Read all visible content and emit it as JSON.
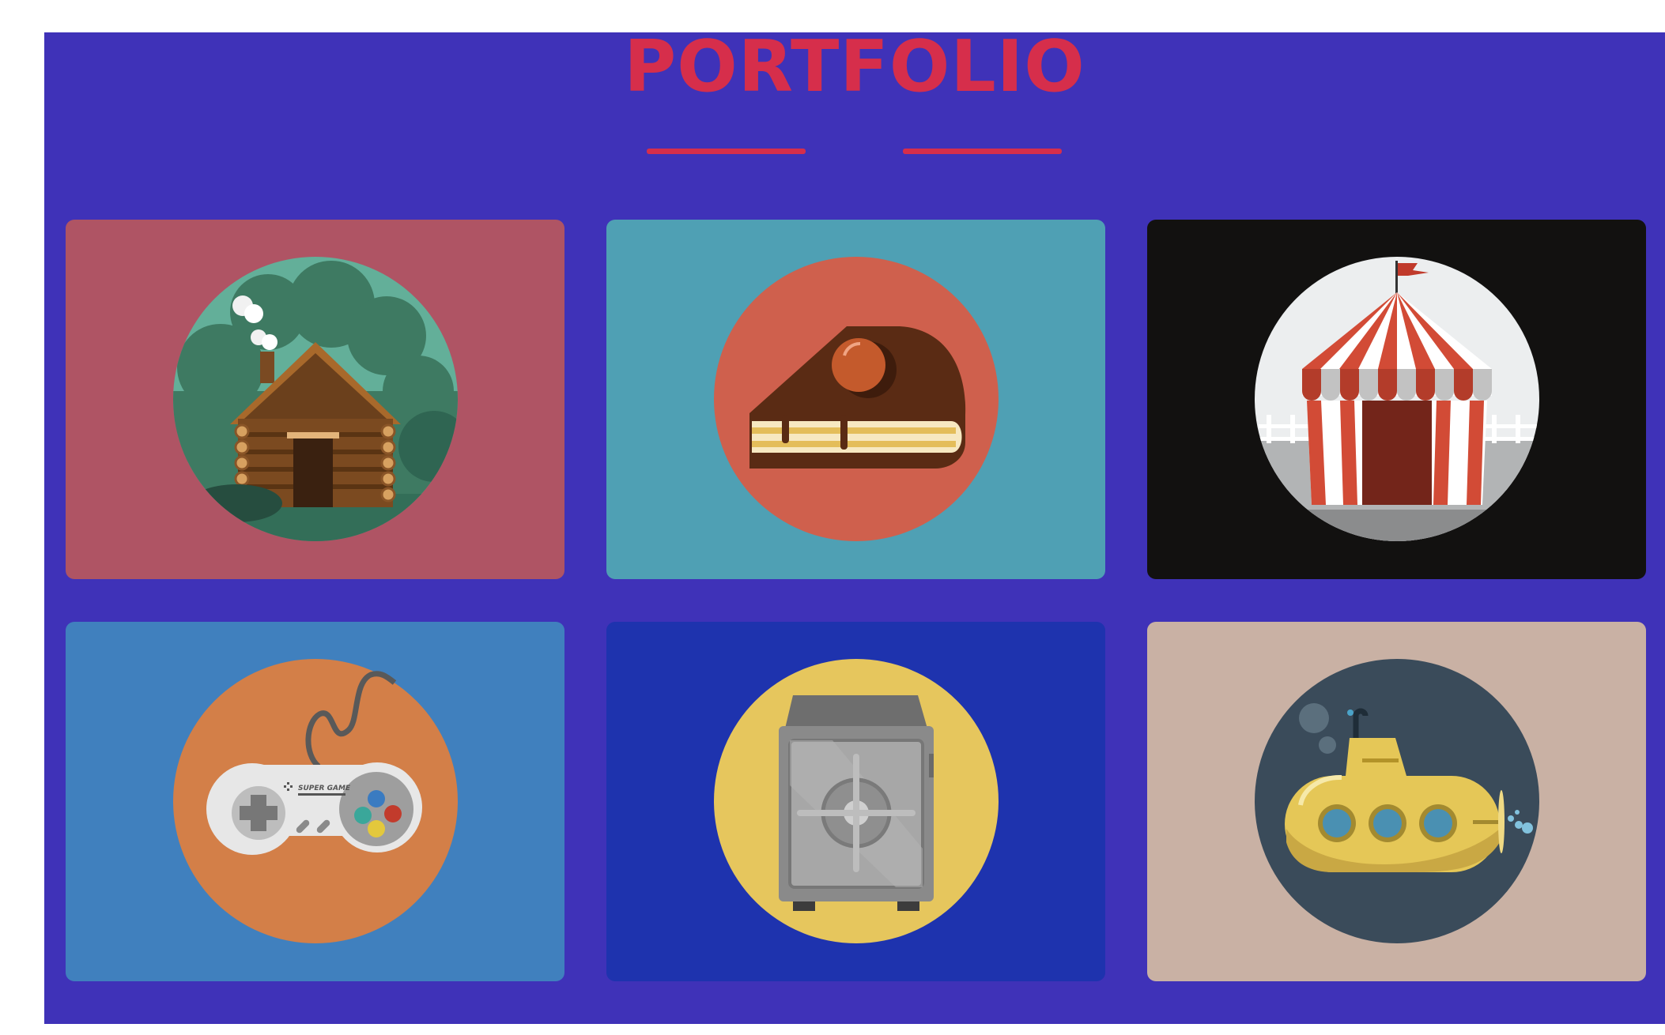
{
  "portfolio": {
    "title": "PORTFOLIO",
    "colors": {
      "section_bg": "#3f32b8",
      "accent": "#d62e4b"
    },
    "items": [
      {
        "icon": "log-cabin-icon",
        "bg": "#af5464"
      },
      {
        "icon": "cake-slice-icon",
        "bg": "#4fa0b4"
      },
      {
        "icon": "circus-tent-icon",
        "bg": "#121110"
      },
      {
        "icon": "game-controller-icon",
        "bg": "#4080be",
        "brand_text": "SUPER GAME"
      },
      {
        "icon": "safe-icon",
        "bg": "#1e33ae"
      },
      {
        "icon": "submarine-icon",
        "bg": "#c9b1a4"
      }
    ]
  }
}
